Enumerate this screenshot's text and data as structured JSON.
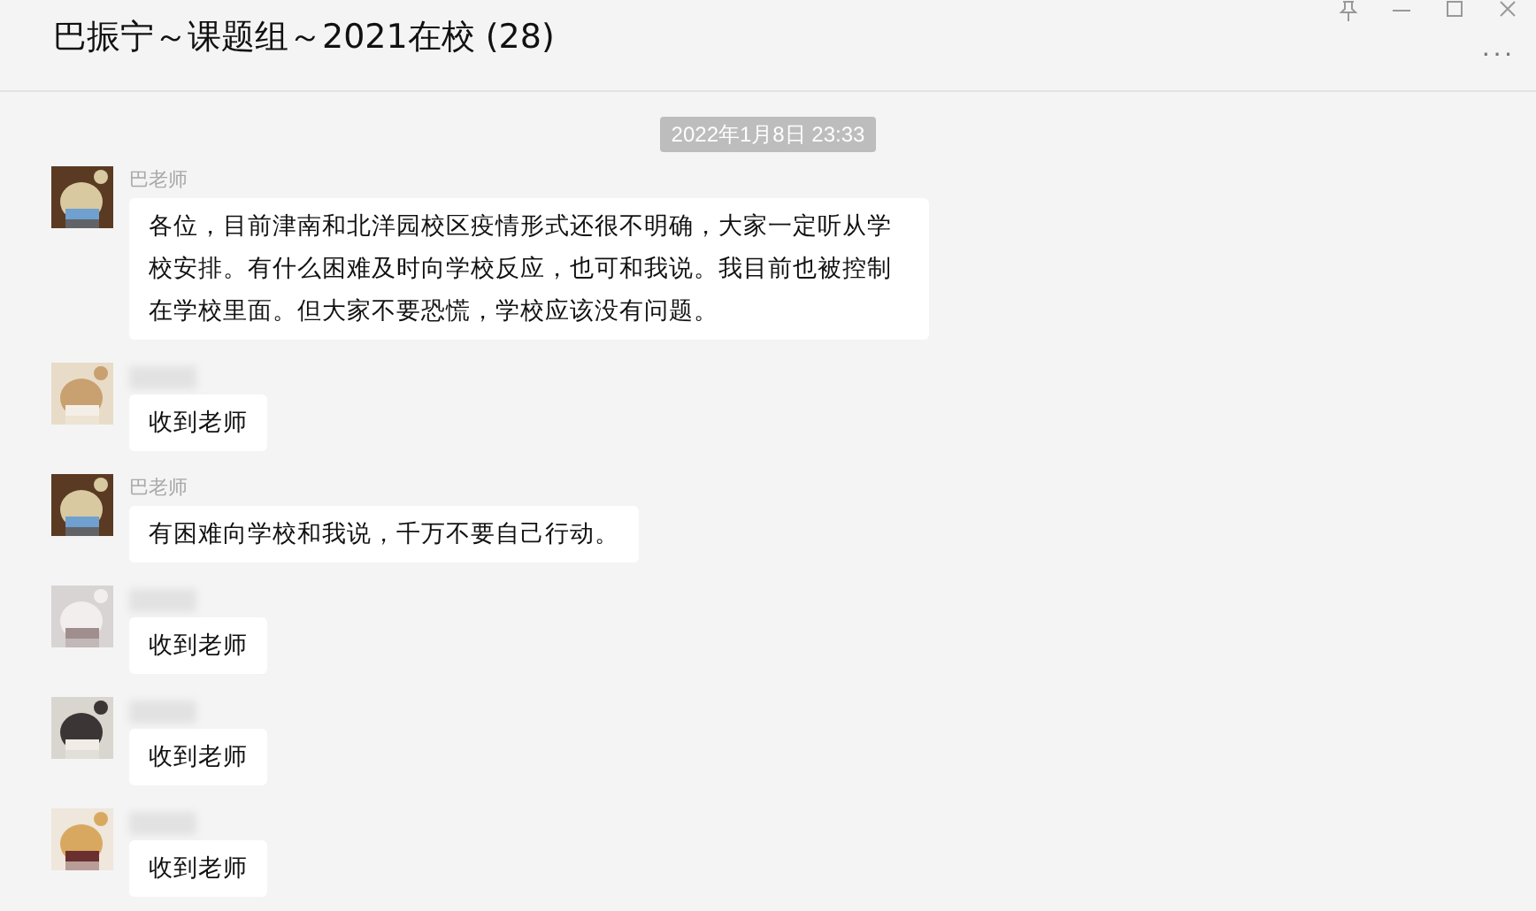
{
  "window": {
    "title": "巴振宁～课题组～2021在校 (28)",
    "more": "···"
  },
  "timestamp": "2022年1月8日 23:33",
  "messages": [
    {
      "sender": "巴老师",
      "name_hidden": false,
      "text": "各位，目前津南和北洋园校区疫情形式还很不明确，大家一定听从学校安排。有什么困难及时向学校反应，也可和我说。我目前也被控制在学校里面。但大家不要恐慌，学校应该没有问题。"
    },
    {
      "name_hidden": true,
      "text": "收到老师"
    },
    {
      "sender": "巴老师",
      "name_hidden": false,
      "text": "有困难向学校和我说，千万不要自己行动。"
    },
    {
      "name_hidden": true,
      "text": "收到老师"
    },
    {
      "name_hidden": true,
      "text": "收到老师"
    },
    {
      "name_hidden": true,
      "text": "收到老师"
    }
  ]
}
